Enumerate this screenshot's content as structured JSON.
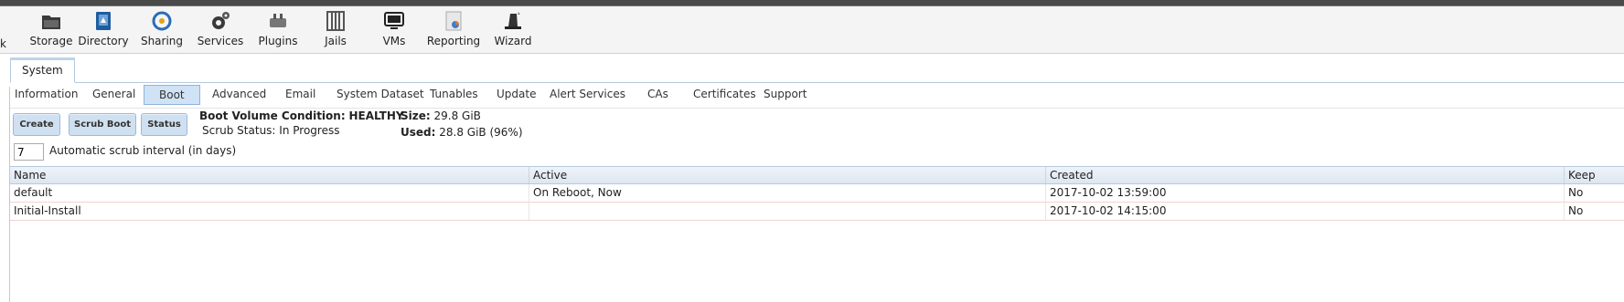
{
  "toolbar": {
    "partial_label": "k",
    "items": [
      {
        "label": "Storage",
        "icon": "storage-icon"
      },
      {
        "label": "Directory",
        "icon": "directory-icon"
      },
      {
        "label": "Sharing",
        "icon": "sharing-icon"
      },
      {
        "label": "Services",
        "icon": "services-icon"
      },
      {
        "label": "Plugins",
        "icon": "plugins-icon"
      },
      {
        "label": "Jails",
        "icon": "jails-icon"
      },
      {
        "label": "VMs",
        "icon": "vms-icon"
      },
      {
        "label": "Reporting",
        "icon": "reporting-icon"
      },
      {
        "label": "Wizard",
        "icon": "wizard-icon"
      }
    ]
  },
  "main_tab": "System",
  "subtabs": [
    "Information",
    "General",
    "Boot",
    "Advanced",
    "Email",
    "System Dataset",
    "Tunables",
    "Update",
    "Alert Services",
    "CAs",
    "Certificates",
    "Support"
  ],
  "active_subtab": "Boot",
  "buttons": {
    "create": "Create",
    "scrub_boot": "Scrub Boot",
    "status": "Status"
  },
  "boot_info": {
    "condition_label": "Boot Volume Condition:",
    "condition_value": "HEALTHY",
    "scrub_status_label": "Scrub Status:",
    "scrub_status_value": "In Progress",
    "size_label": "Size:",
    "size_value": "29.8 GiB",
    "used_label": "Used:",
    "used_value": "28.8 GiB (96%)"
  },
  "scrub_interval": {
    "value": "7",
    "label": "Automatic scrub interval (in days)"
  },
  "grid": {
    "columns": [
      "Name",
      "Active",
      "Created",
      "Keep"
    ],
    "rows": [
      {
        "name": "default",
        "active": "On Reboot, Now",
        "created": "2017-10-02 13:59:00",
        "keep": "No"
      },
      {
        "name": "Initial-Install",
        "active": "",
        "created": "2017-10-02 14:15:00",
        "keep": "No"
      }
    ]
  }
}
